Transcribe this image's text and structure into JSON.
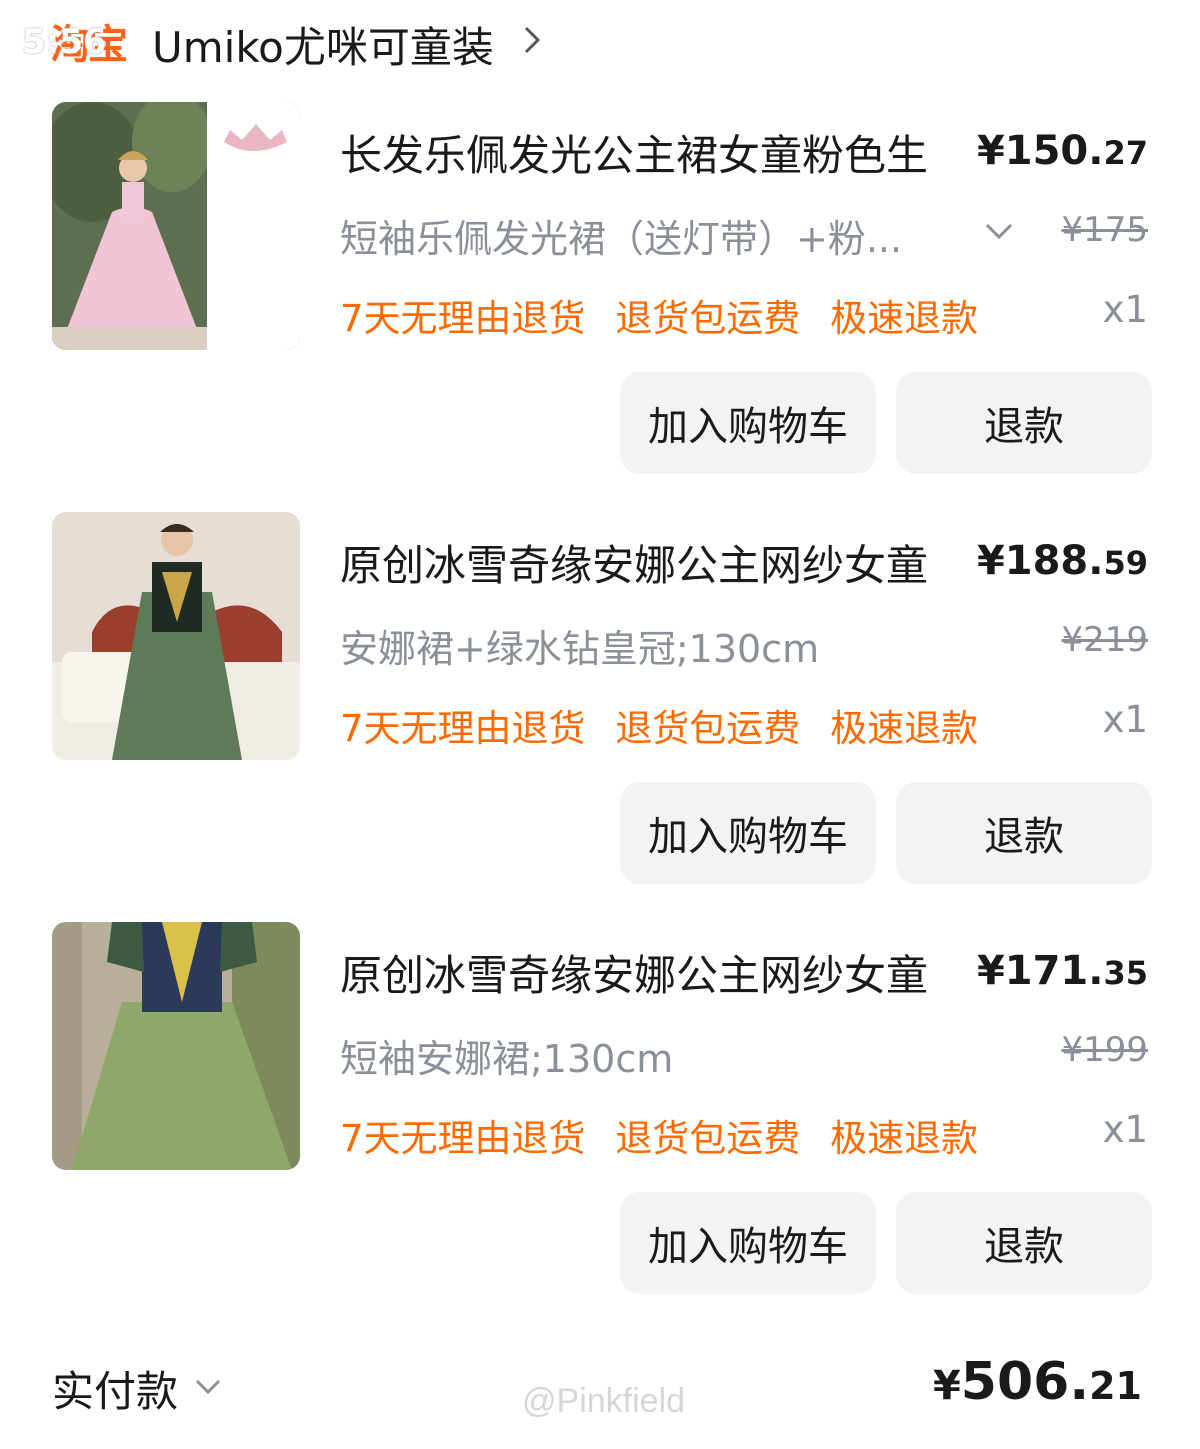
{
  "status_bar": {
    "time": "5:56"
  },
  "header": {
    "logo_text": "淘宝",
    "shop_name": "Umiko尤咪可童装"
  },
  "items": [
    {
      "title": "长发乐佩发光公主裙女童粉色生",
      "price_int": "¥150.",
      "price_dec": "27",
      "spec": "短袖乐佩发光裙（送灯带）+粉...",
      "orig_price": "¥175",
      "tags": [
        "7天无理由退货",
        "退货包运费",
        "极速退款"
      ],
      "qty": "x1",
      "cart_label": "加入购物车",
      "refund_label": "退款"
    },
    {
      "title": "原创冰雪奇缘安娜公主网纱女童",
      "price_int": "¥188.",
      "price_dec": "59",
      "spec": "安娜裙+绿水钻皇冠;130cm",
      "orig_price": "¥219",
      "tags": [
        "7天无理由退货",
        "退货包运费",
        "极速退款"
      ],
      "qty": "x1",
      "cart_label": "加入购物车",
      "refund_label": "退款"
    },
    {
      "title": "原创冰雪奇缘安娜公主网纱女童",
      "price_int": "¥171.",
      "price_dec": "35",
      "spec": "短袖安娜裙;130cm",
      "orig_price": "¥199",
      "tags": [
        "7天无理由退货",
        "退货包运费",
        "极速退款"
      ],
      "qty": "x1",
      "cart_label": "加入购物车",
      "refund_label": "退款"
    }
  ],
  "footer": {
    "pay_label": "实付款",
    "total_cur": "¥",
    "total_int": "506.",
    "total_dec": "21",
    "watermark": "@Pinkfield"
  },
  "colors": {
    "accent": "#ff6a00",
    "muted": "#8a8f99",
    "button_bg": "#f2f3f5"
  },
  "icons": [
    "chevron-right-icon",
    "chevron-down-icon"
  ]
}
